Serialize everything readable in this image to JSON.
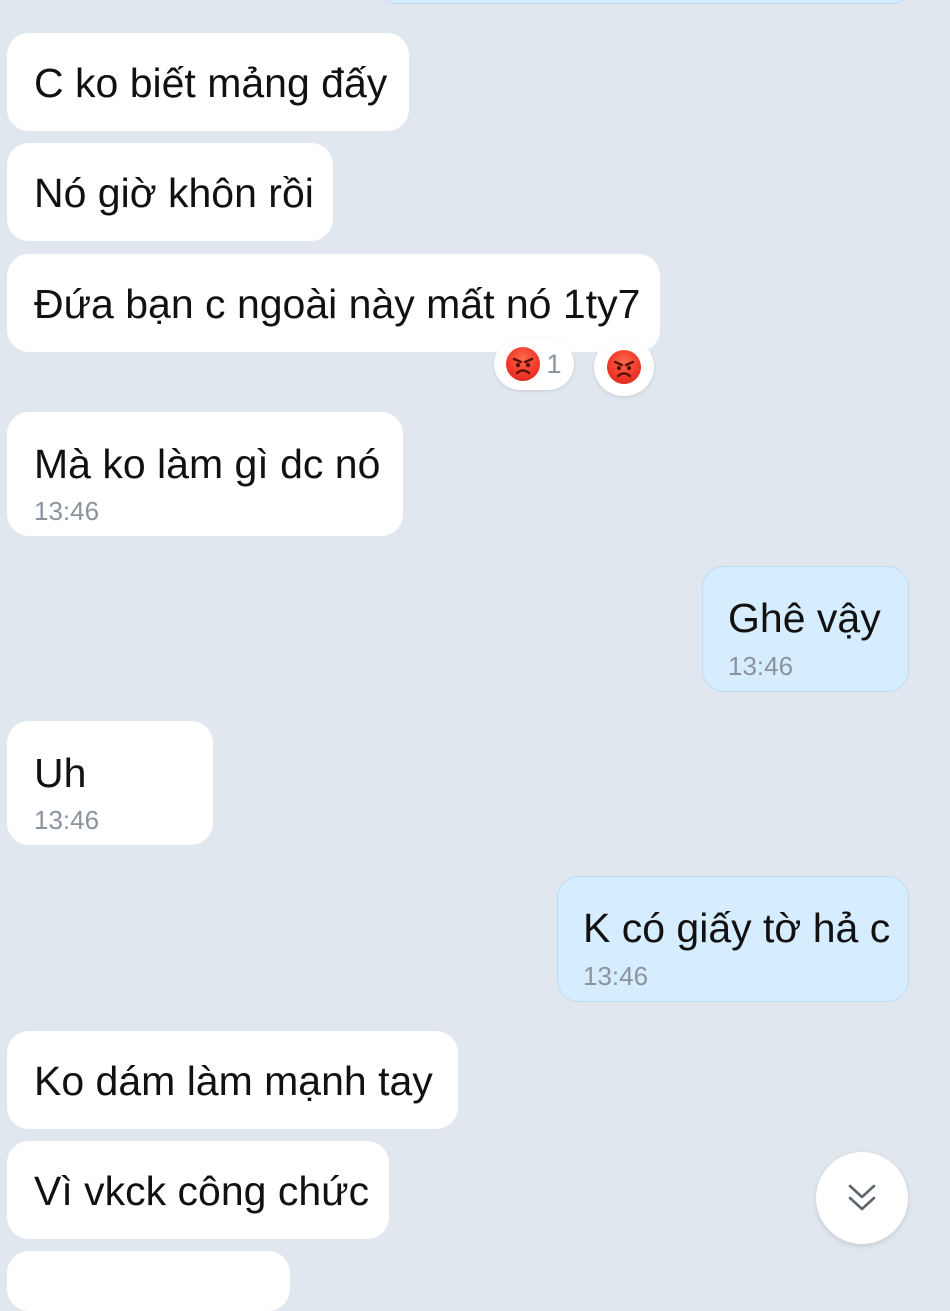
{
  "messages": [
    {
      "text": "C ko biết mảng đấy"
    },
    {
      "text": "Nó giờ khôn rồi"
    },
    {
      "text": "Đứa bạn c ngoài này mất nó 1ty7"
    },
    {
      "text": "Mà ko làm gì dc nó",
      "time": "13:46"
    },
    {
      "text": "Ghê vậy",
      "time": "13:46"
    },
    {
      "text": "Uh",
      "time": "13:46"
    },
    {
      "text": "K có giấy tờ hả c",
      "time": "13:46"
    },
    {
      "text": "Ko dám làm mạnh tay"
    },
    {
      "text": "Vì vkck công chức"
    }
  ],
  "reactions": [
    {
      "icon": "angry-face-icon",
      "count": "1"
    },
    {
      "icon": "angry-face-icon"
    }
  ],
  "colors": {
    "background": "#e1e7ef",
    "incoming_bubble": "#ffffff",
    "outgoing_bubble": "#d5edfe",
    "outgoing_border": "#bcdcf6",
    "timestamp": "#8a939e",
    "reaction_red": "#f0392a"
  },
  "scroll_button": {
    "icon": "double-chevron-down-icon"
  }
}
